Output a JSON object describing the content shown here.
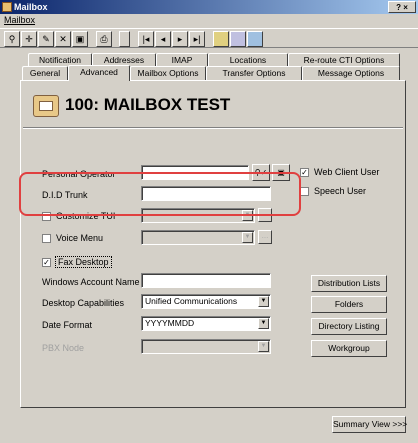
{
  "window": {
    "title": "Mailbox",
    "buttons": "? ×"
  },
  "menu": {
    "item": "Mailbox"
  },
  "toolbar": {
    "b1": "⚲",
    "b2": "✛",
    "b3": "✎",
    "b4": "✕",
    "b5": "▣",
    "b6": "⎙",
    "first": "|◂",
    "prev": "◂",
    "next": "▸",
    "last": "▸|"
  },
  "tabs": {
    "notification": "Notification",
    "addresses": "Addresses",
    "imap": "IMAP",
    "locations": "Locations",
    "reroute": "Re-route CTI Options",
    "general": "General",
    "advanced": "Advanced",
    "mailbox_options": "Mailbox Options",
    "transfer_options": "Transfer Options",
    "message_options": "Message Options"
  },
  "header": {
    "title": "100: MAILBOX TEST"
  },
  "icons": {
    "dropdown": "▼",
    "more": "…"
  },
  "form": {
    "personal_operator": {
      "label": "Personal Operator",
      "value": "",
      "lookup_glyph": "⚲✓",
      "clear_glyph": "▣"
    },
    "web_client_user": {
      "label": "Web Client User",
      "mark": "✓"
    },
    "speech_user": {
      "label": "Speech User",
      "mark": ""
    },
    "did_trunk": {
      "label": "D.I.D Trunk",
      "value": ""
    },
    "customize_tui": {
      "label": "Customize TUI",
      "mark": ""
    },
    "voice_menu": {
      "label": "Voice Menu",
      "mark": ""
    },
    "fax_desktop": {
      "label": "Fax Desktop",
      "mark": "✓"
    },
    "windows_account": {
      "label": "Windows Account Name",
      "value": ""
    },
    "desktop_capabilities": {
      "label": "Desktop Capabilities",
      "value": "Unified Communications"
    },
    "date_format": {
      "label": "Date Format",
      "value": "YYYYMMDD"
    },
    "pbx_node": {
      "label": "PBX Node"
    }
  },
  "buttons": {
    "distribution_lists": "Distribution Lists",
    "folders": "Folders",
    "directory_listing": "Directory Listing",
    "workgroup": "Workgroup",
    "summary_view": "Summary View >>>"
  }
}
